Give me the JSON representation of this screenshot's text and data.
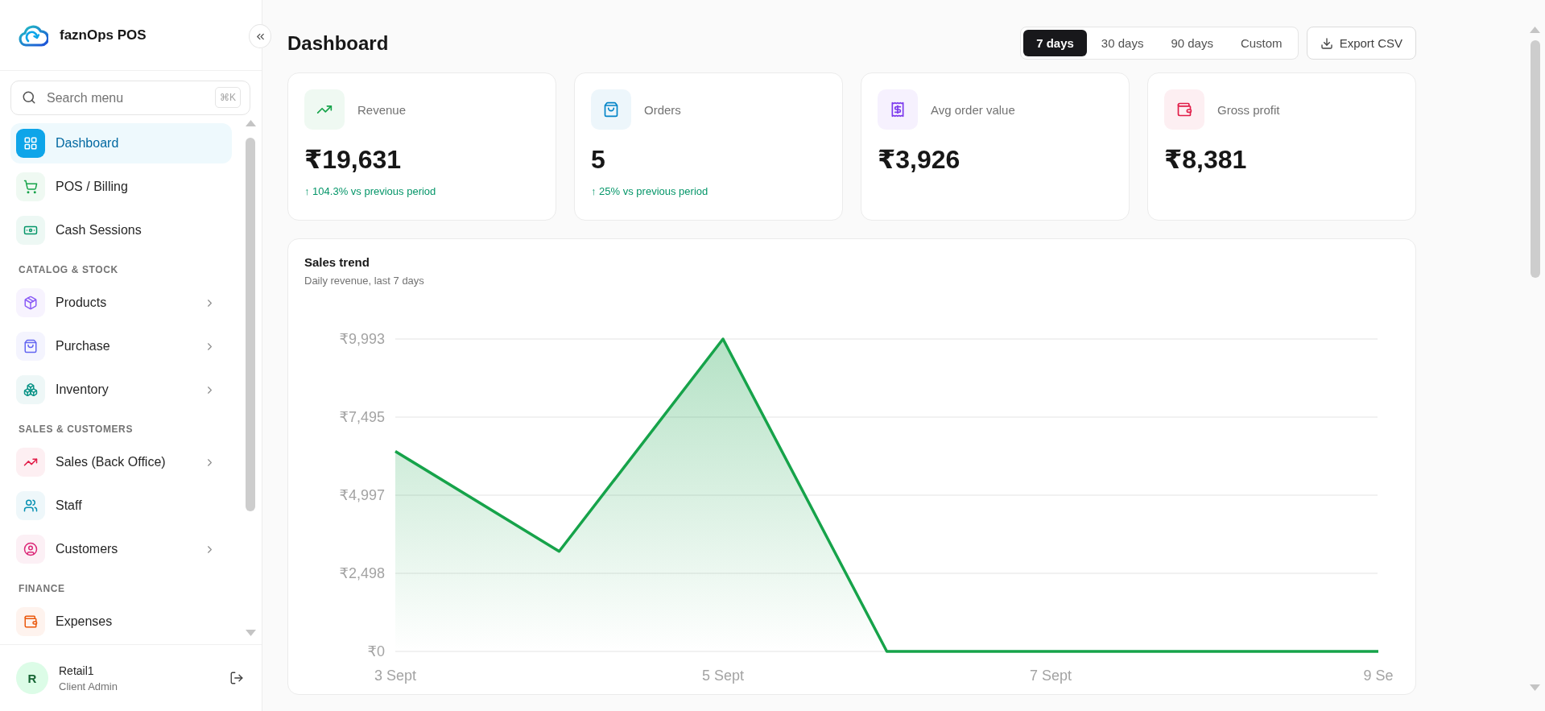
{
  "sidebar": {
    "brand": "faznOps POS",
    "search": {
      "placeholder": "Search menu",
      "shortcut": "⌘K"
    },
    "sections": [
      {
        "items": [
          {
            "label": "Dashboard",
            "selected": true,
            "expandable": false,
            "color": "#0ea5e9"
          },
          {
            "label": "POS / Billing",
            "selected": false,
            "expandable": false,
            "color": "#16a34a"
          },
          {
            "label": "Cash Sessions",
            "selected": false,
            "expandable": false,
            "color": "#059669"
          }
        ]
      },
      {
        "title": "CATALOG & STOCK",
        "items": [
          {
            "label": "Products",
            "selected": false,
            "expandable": true,
            "color": "#8b5cf6"
          },
          {
            "label": "Purchase",
            "selected": false,
            "expandable": true,
            "color": "#6366f1"
          },
          {
            "label": "Inventory",
            "selected": false,
            "expandable": true,
            "color": "#0d9488"
          }
        ]
      },
      {
        "title": "SALES & CUSTOMERS",
        "items": [
          {
            "label": "Sales (Back Office)",
            "selected": false,
            "expandable": true,
            "color": "#e11d48"
          },
          {
            "label": "Staff",
            "selected": false,
            "expandable": false,
            "color": "#0891b2"
          },
          {
            "label": "Customers",
            "selected": false,
            "expandable": true,
            "color": "#db2777"
          }
        ]
      },
      {
        "title": "FINANCE",
        "items": [
          {
            "label": "Expenses",
            "selected": false,
            "expandable": false,
            "color": "#ea580c"
          }
        ]
      }
    ],
    "user": {
      "initial": "R",
      "name": "Retail1",
      "role": "Client Admin"
    }
  },
  "main": {
    "title": "Dashboard",
    "range_tabs": [
      {
        "label": "7 days",
        "selected": true
      },
      {
        "label": "30 days",
        "selected": false
      },
      {
        "label": "90 days",
        "selected": false
      },
      {
        "label": "Custom",
        "selected": false
      }
    ],
    "export_button": "Export CSV",
    "stats": [
      {
        "label": "Revenue",
        "value": "₹19,631",
        "change": "↑ 104.3% vs previous period",
        "color": "#16a34a"
      },
      {
        "label": "Orders",
        "value": "5",
        "change": "↑ 25% vs previous period",
        "color": "#0284c7"
      },
      {
        "label": "Avg order value",
        "value": "₹3,926",
        "color": "#7c3aed"
      },
      {
        "label": "Gross profit",
        "value": "₹8,381",
        "color": "#e11d48"
      }
    ],
    "sales_trend": {
      "title": "Sales trend",
      "subtitle": "Daily revenue, last 7 days",
      "chart_data": {
        "type": "area",
        "grid": true,
        "categories": [
          "3 Sept",
          null,
          "5 Sept",
          null,
          "7 Sept",
          null,
          "9 Se"
        ],
        "series": [
          {
            "color": "#16a34a",
            "values": [
              6400,
              3200,
              9993,
              0,
              0,
              0,
              0
            ]
          }
        ],
        "ylim": [
          0,
          9993
        ],
        "yticks": [
          {
            "value": 0,
            "label": "₹0"
          },
          {
            "value": 2498,
            "label": "₹2,498"
          },
          {
            "value": 4997,
            "label": "₹4,997"
          },
          {
            "value": 7495,
            "label": "₹7,495"
          },
          {
            "value": 9993,
            "label": "₹9,993"
          }
        ]
      }
    }
  }
}
